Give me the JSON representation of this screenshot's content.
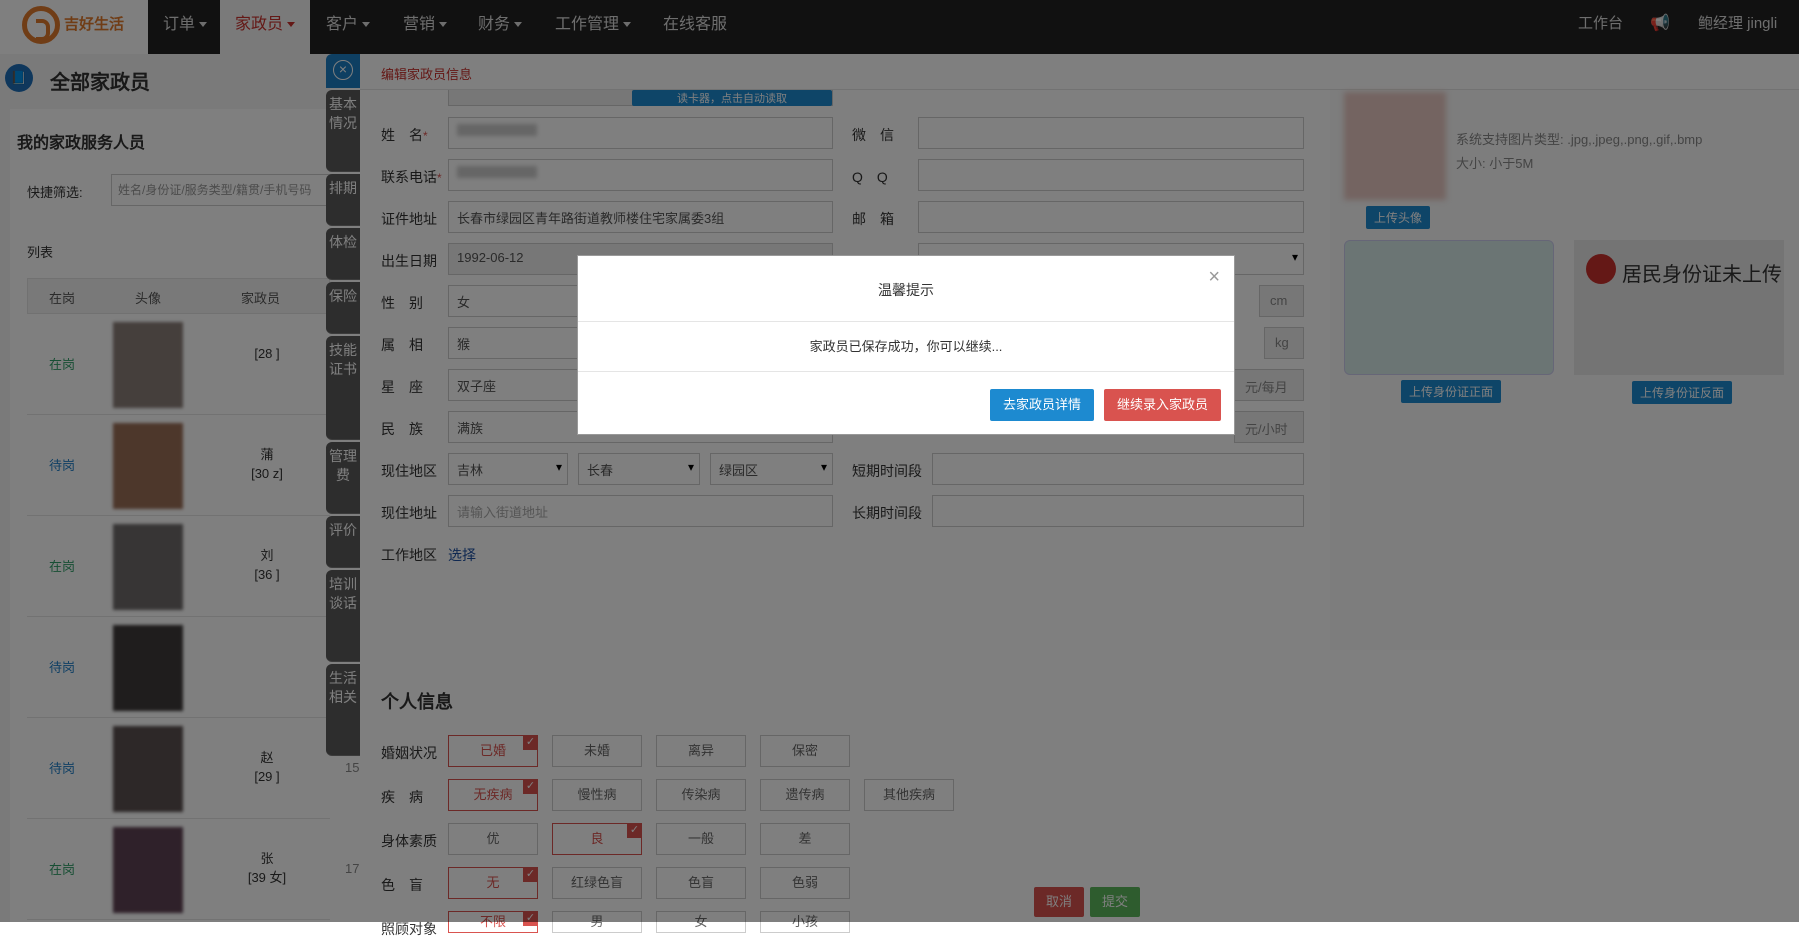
{
  "topnav": {
    "logo": "吉好生活",
    "items": [
      {
        "label": "订单"
      },
      {
        "label": "家政员"
      },
      {
        "label": "客户"
      },
      {
        "label": "营销"
      },
      {
        "label": "财务"
      },
      {
        "label": "工作管理"
      },
      {
        "label": "在线客服"
      }
    ],
    "workbench": "工作台",
    "user": "鲍经理 jingli"
  },
  "left": {
    "page_title": "全部家政员",
    "panel_title": "我的家政服务人员",
    "filter_label": "快捷筛选:",
    "filter_placeholder": "姓名/身份证/服务类型/籍贯/手机号码",
    "list_label": "列表",
    "columns": [
      "在岗",
      "头像",
      "家政员"
    ],
    "rows": [
      {
        "status": "在岗",
        "name": "",
        "sub": "[28  ]"
      },
      {
        "status": "待岗",
        "name": "蒲",
        "sub": "[30  z]"
      },
      {
        "status": "在岗",
        "name": "刘  ",
        "sub": "[36  ]"
      },
      {
        "status": "待岗",
        "name": "",
        "sub": ""
      },
      {
        "status": "待岗",
        "name": "赵  ",
        "sub": "[29  ]",
        "extra": "15"
      },
      {
        "status": "在岗",
        "name": "张  ",
        "sub": "[39  女]",
        "extra": "17"
      }
    ]
  },
  "tabs": [
    "基本情况",
    "排期",
    "体检",
    "保险",
    "技能证书",
    "管理费",
    "评价",
    "培训谈话",
    "生活相关"
  ],
  "editor": {
    "title": "编辑家政员信息",
    "fields": {
      "name_label": "姓　名",
      "phone_label": "联系电话",
      "id_addr_label": "证件地址",
      "id_addr": "长春市绿园区青年路街道教师楼住宅家属委3组",
      "birth_label": "出生日期",
      "birth": "1992-06-12",
      "gender_label": "性　别",
      "gender": "女",
      "zodiac_label": "属　相",
      "zodiac": "猴",
      "star_label": "星　座",
      "star": "双子座",
      "nation_label": "民　族",
      "nation": "满族",
      "region_label": "现住地区",
      "province": "吉林",
      "city": "长春",
      "district": "绿园区",
      "addr_label": "现住地址",
      "addr_placeholder": "请输入街道地址",
      "work_label": "工作地区",
      "work_link": "选择",
      "wechat_label": "微　信",
      "qq_label": "Q　Q",
      "email_label": "邮　箱",
      "short_label": "短期时间段",
      "long_label": "长期时间段",
      "unit_cm": "cm",
      "unit_kg": "kg",
      "unit_month": "元/每月",
      "unit_hour": "元/小时",
      "reader_btn": "读卡器，点击自动读取"
    },
    "personal": {
      "title": "个人信息",
      "groups": [
        {
          "label": "婚姻状况",
          "options": [
            "已婚",
            "未婚",
            "离异",
            "保密"
          ],
          "selected": 0
        },
        {
          "label": "疾　病",
          "options": [
            "无疾病",
            "慢性病",
            "传染病",
            "遗传病",
            "其他疾病"
          ],
          "selected": 0
        },
        {
          "label": "身体素质",
          "options": [
            "优",
            "良",
            "一般",
            "差"
          ],
          "selected": 1
        },
        {
          "label": "色　盲",
          "options": [
            "无",
            "红绿色盲",
            "色盲",
            "色弱"
          ],
          "selected": 0
        },
        {
          "label": "照顾对象",
          "options": [
            "不限",
            "男",
            "女",
            "小孩"
          ],
          "selected": 0
        }
      ]
    },
    "photos": {
      "upload_avatar": "上传头像",
      "hint1": "系统支持图片类型: .jpg,.jpeg,.png,.gif,.bmp",
      "hint2": "大小: 小于5M",
      "upload_front": "上传身份证正面",
      "upload_back": "上传身份证反面",
      "id_back_text": "居民身份证未上传"
    },
    "cancel": "取消",
    "submit": "提交"
  },
  "modal": {
    "title": "温馨提示",
    "message": "家政员已保存成功，你可以继续...",
    "btn_detail": "去家政员详情",
    "btn_continue": "继续录入家政员"
  },
  "colors": {
    "primary": "#1d8ad0",
    "danger": "#d9534f",
    "success": "#5cb85c"
  }
}
